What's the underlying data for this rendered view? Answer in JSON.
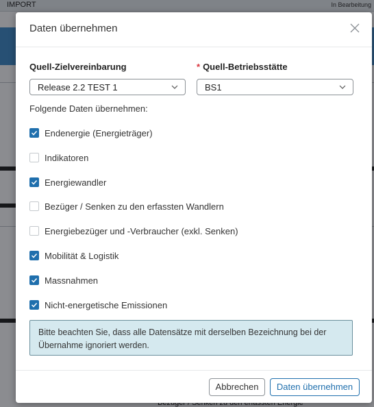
{
  "background": {
    "top_label": "IMPORT",
    "top_right_label": "In Bearbeitung",
    "bottom_text": "Bezüger / Senken zu den erfassten Energie"
  },
  "dialog": {
    "title": "Daten übernehmen",
    "source_agreement": {
      "label": "Quell-Zielvereinbarung",
      "value": "Release 2.2 TEST 1"
    },
    "source_site": {
      "required_mark": "*",
      "label": "Quell-Betriebsstätte",
      "value": "BS1"
    },
    "section_label": "Folgende Daten übernehmen:",
    "options": [
      {
        "label": "Endenergie (Energieträger)",
        "checked": true
      },
      {
        "label": "Indikatoren",
        "checked": false
      },
      {
        "label": "Energiewandler",
        "checked": true
      },
      {
        "label": "Bezüger / Senken zu den erfassten Wandlern",
        "checked": false
      },
      {
        "label": "Energiebezüger und -Verbraucher (exkl. Senken)",
        "checked": false
      },
      {
        "label": "Mobilität & Logistik",
        "checked": true
      },
      {
        "label": "Massnahmen",
        "checked": true
      },
      {
        "label": "Nicht-energetische Emissionen",
        "checked": true
      }
    ],
    "notice": "Bitte beachten Sie, dass alle Datensätze mit derselben Bezeichnung bei der Übernahme ignoriert werden.",
    "cancel_label": "Abbrechen",
    "confirm_label": "Daten übernehmen"
  },
  "colors": {
    "accent": "#1f6fad",
    "required": "#d9363e",
    "notice_bg": "#d5e9ef"
  }
}
